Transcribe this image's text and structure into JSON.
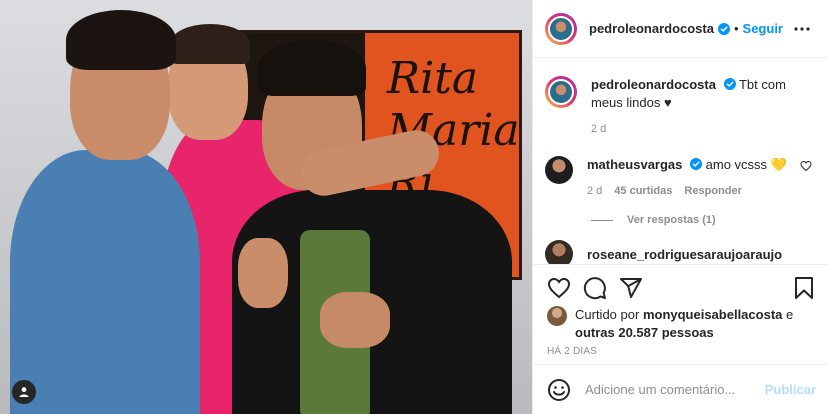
{
  "photo": {
    "poster_text": [
      "Rita",
      "Maria",
      "Ri"
    ]
  },
  "header": {
    "username": "pedroleonardocosta",
    "separator": "•",
    "follow_label": "Seguir"
  },
  "caption": {
    "username": "pedroleonardocosta",
    "text": "Tbt com meus lindos ♥",
    "time": "2 d"
  },
  "comment": {
    "username": "matheusvargas",
    "text": "amo vcsss 💛",
    "time": "2 d",
    "likes": "45 curtidas",
    "reply_label": "Responder",
    "view_replies": "Ver respostas (1)"
  },
  "partial_comment": {
    "username": "roseane_rodriguesaraujoaraujo"
  },
  "likes": {
    "prefix": "Curtido por",
    "user": "monyqueisabellacosta",
    "joiner": "e",
    "others": "outras 20.587 pessoas"
  },
  "post_date": "HÁ 2 DIAS",
  "add_comment": {
    "placeholder": "Adicione um comentário...",
    "post_label": "Publicar"
  },
  "colors": {
    "accent": "#0095f6",
    "publish_disabled": "#b2dffc",
    "muted": "#8e8e8e",
    "verified": "#0095f6"
  },
  "icons": [
    "verified-badge-icon",
    "more-options-icon",
    "heart-icon",
    "comment-icon",
    "share-icon",
    "bookmark-icon",
    "emoji-icon",
    "user-tag-icon"
  ]
}
